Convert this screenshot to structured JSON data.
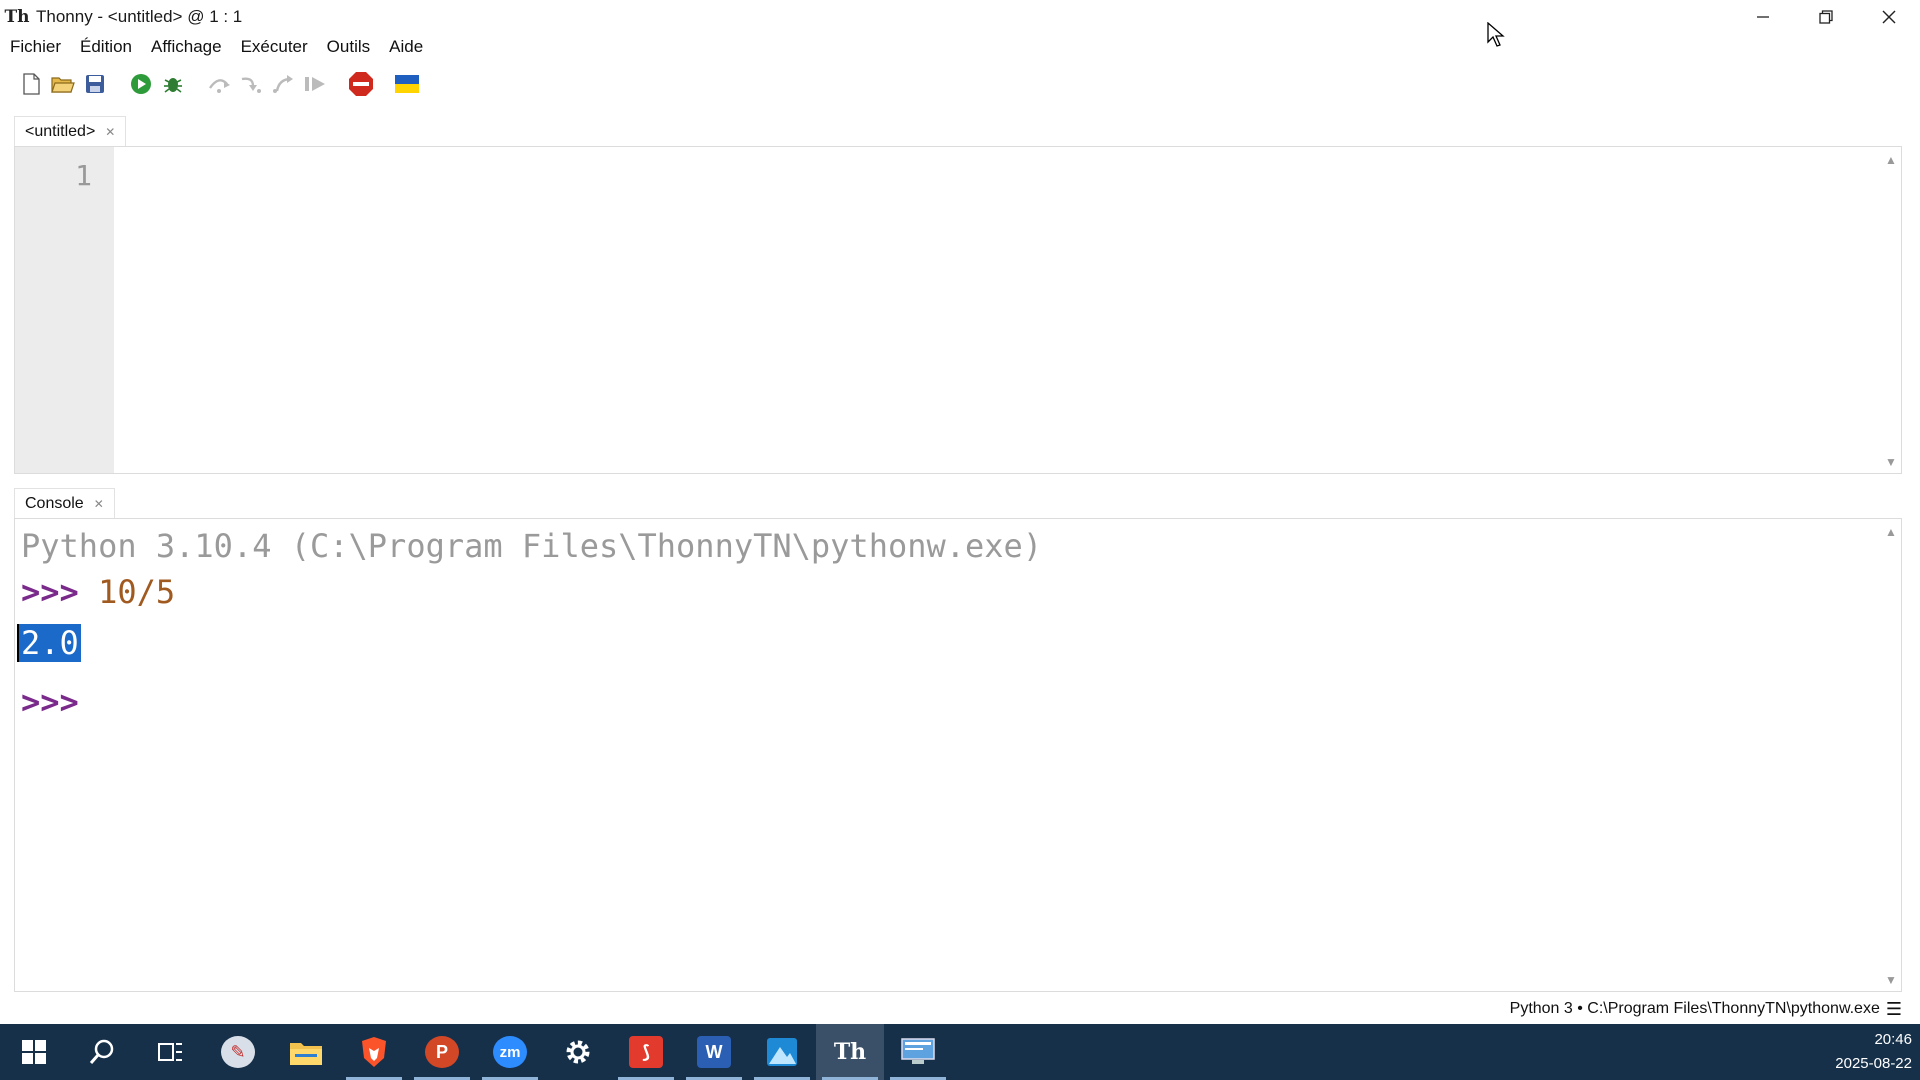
{
  "window": {
    "app_icon_text": "Th",
    "title": "Thonny - <untitled> @ 1 : 1"
  },
  "menu": [
    {
      "label": "Fichier"
    },
    {
      "label": "Édition"
    },
    {
      "label": "Affichage"
    },
    {
      "label": "Exécuter"
    },
    {
      "label": "Outils"
    },
    {
      "label": "Aide"
    }
  ],
  "toolbar_icons": [
    "new-file-icon",
    "open-file-icon",
    "save-icon",
    "run-icon",
    "debug-icon",
    "step-over-icon",
    "step-into-icon",
    "step-out-icon",
    "resume-icon",
    "stop-icon",
    "ukraine-flag-icon"
  ],
  "editor": {
    "tab_label": "<untitled>",
    "line_numbers": [
      "1"
    ]
  },
  "console": {
    "tab_label": "Console",
    "banner": "Python 3.10.4 (C:\\Program Files\\ThonnyTN\\pythonw.exe)",
    "prompt": ">>>",
    "command": "10/5",
    "result": "2.0"
  },
  "status": {
    "interpreter": "Python 3  •  C:\\Program Files\\ThonnyTN\\pythonw.exe"
  },
  "taskbar": {
    "time": "20:46",
    "date": "2025-08-22"
  },
  "colors": {
    "taskbar_bg": "#16304a",
    "selection": "#1b6ac9",
    "prompt": "#7a2a8a",
    "command": "#a05a20"
  }
}
